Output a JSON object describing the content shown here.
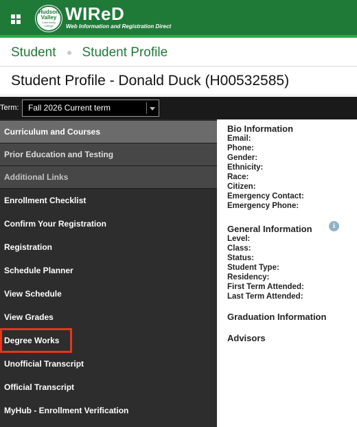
{
  "header": {
    "seal_lines": [
      "Hudson",
      "Valley",
      "Community",
      "College"
    ],
    "brand": "WIReD",
    "tagline": "Web Information and Registration Direct",
    "menu_icon": "apps-grid-icon"
  },
  "breadcrumb": [
    "Student",
    "Student Profile"
  ],
  "page_title": "Student Profile - Donald Duck (H00532585)",
  "term": {
    "label": "Term:",
    "selected": "Fall 2026 Current term"
  },
  "sidebar": {
    "sections": [
      "Curriculum and Courses",
      "Prior Education and Testing",
      "Additional Links"
    ],
    "links": [
      "Enrollment Checklist",
      "Confirm Your Registration",
      "Registration",
      "Schedule Planner",
      "View Schedule",
      "View Grades",
      "Degree Works",
      "Unofficial Transcript",
      "Official Transcript",
      "MyHub - Enrollment Verification"
    ]
  },
  "bio": {
    "heading": "Bio Information",
    "fields": [
      "Email:",
      "Phone:",
      "Gender:",
      "Ethnicity:",
      "Race:",
      "Citizen:",
      "Emergency Contact:",
      "Emergency Phone:"
    ]
  },
  "general": {
    "heading": "General Information",
    "fields": [
      "Level:",
      "Class:",
      "Status:",
      "Student Type:",
      "Residency:",
      "First Term Attended:",
      "Last Term Attended:"
    ]
  },
  "graduation": {
    "heading": "Graduation Information"
  },
  "advisors": {
    "heading": "Advisors"
  },
  "colors": {
    "brand_green": "#1f7a38",
    "highlight": "#e8351e",
    "sidebar_bg": "#2d2d2d"
  }
}
